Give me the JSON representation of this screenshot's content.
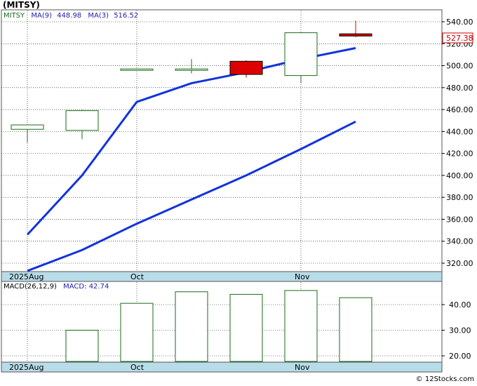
{
  "title": "(MITSY)",
  "watermark": "© 12Stocks.com",
  "colors": {
    "up": "#1a6b1a",
    "down": "#dd0000",
    "ma": "#1133dd",
    "date_band": "#b8dce8",
    "price_tag_text": "#cc0000",
    "legend_text": "#2222aa",
    "grid": "#000000"
  },
  "chart_data": [
    {
      "type": "candlestick",
      "title": "(MITSY)",
      "legend": [
        {
          "label": "MITSY",
          "value": "",
          "color": "#1a6b1a"
        },
        {
          "label": "MA(9)",
          "value": "448.98",
          "color": "#2222aa"
        },
        {
          "label": "MA(3)",
          "value": "516.52",
          "color": "#2222aa"
        }
      ],
      "last_price_tag": "527.38",
      "ylim": [
        310,
        550
      ],
      "y_ticks": [
        320,
        340,
        360,
        380,
        400,
        420,
        440,
        460,
        480,
        500,
        520,
        540
      ],
      "y_tick_labels": [
        "320.00",
        "340.00",
        "360.00",
        "380.00",
        "400.00",
        "420.00",
        "440.00",
        "460.00",
        "480.00",
        "500.00",
        "520.00",
        "540.00"
      ],
      "x_labels": [
        {
          "index": 0,
          "text": "2025Aug"
        },
        {
          "index": 2,
          "text": "Oct"
        },
        {
          "index": 5,
          "text": "Nov"
        }
      ],
      "candles": [
        {
          "open": 442,
          "high": 446,
          "low": 430,
          "close": 446
        },
        {
          "open": 441,
          "high": 460,
          "low": 433,
          "close": 459
        },
        {
          "open": 497,
          "high": 497,
          "low": 497,
          "close": 497
        },
        {
          "open": 497,
          "high": 506,
          "low": 493,
          "close": 497
        },
        {
          "open": 504,
          "high": 505,
          "low": 489,
          "close": 492
        },
        {
          "open": 491,
          "high": 530,
          "low": 484,
          "close": 530
        },
        {
          "open": 529,
          "high": 541,
          "low": 526,
          "close": 527
        }
      ],
      "series": [
        {
          "name": "MA(3)",
          "values": [
            346,
            400,
            467,
            484,
            494,
            506,
            516
          ]
        },
        {
          "name": "MA(9)",
          "values": [
            313,
            332,
            356,
            378,
            400,
            424,
            449
          ]
        }
      ]
    },
    {
      "type": "bar",
      "title": "MACD(26,12,9)",
      "legend": [
        {
          "label": "MACD(26,12,9)",
          "value": "",
          "color": "#000000"
        },
        {
          "label": "MACD:",
          "value": "42.74",
          "color": "#2222aa"
        }
      ],
      "ylim": [
        15,
        50
      ],
      "y_ticks": [
        20,
        30,
        40
      ],
      "y_tick_labels": [
        "20.00",
        "30.00",
        "40.00"
      ],
      "x_labels": [
        {
          "index": 0,
          "text": "2025Aug"
        },
        {
          "index": 2,
          "text": "Oct"
        },
        {
          "index": 5,
          "text": "Nov"
        }
      ],
      "values": [
        null,
        30,
        40.5,
        45,
        44,
        45.5,
        42.7
      ]
    }
  ]
}
